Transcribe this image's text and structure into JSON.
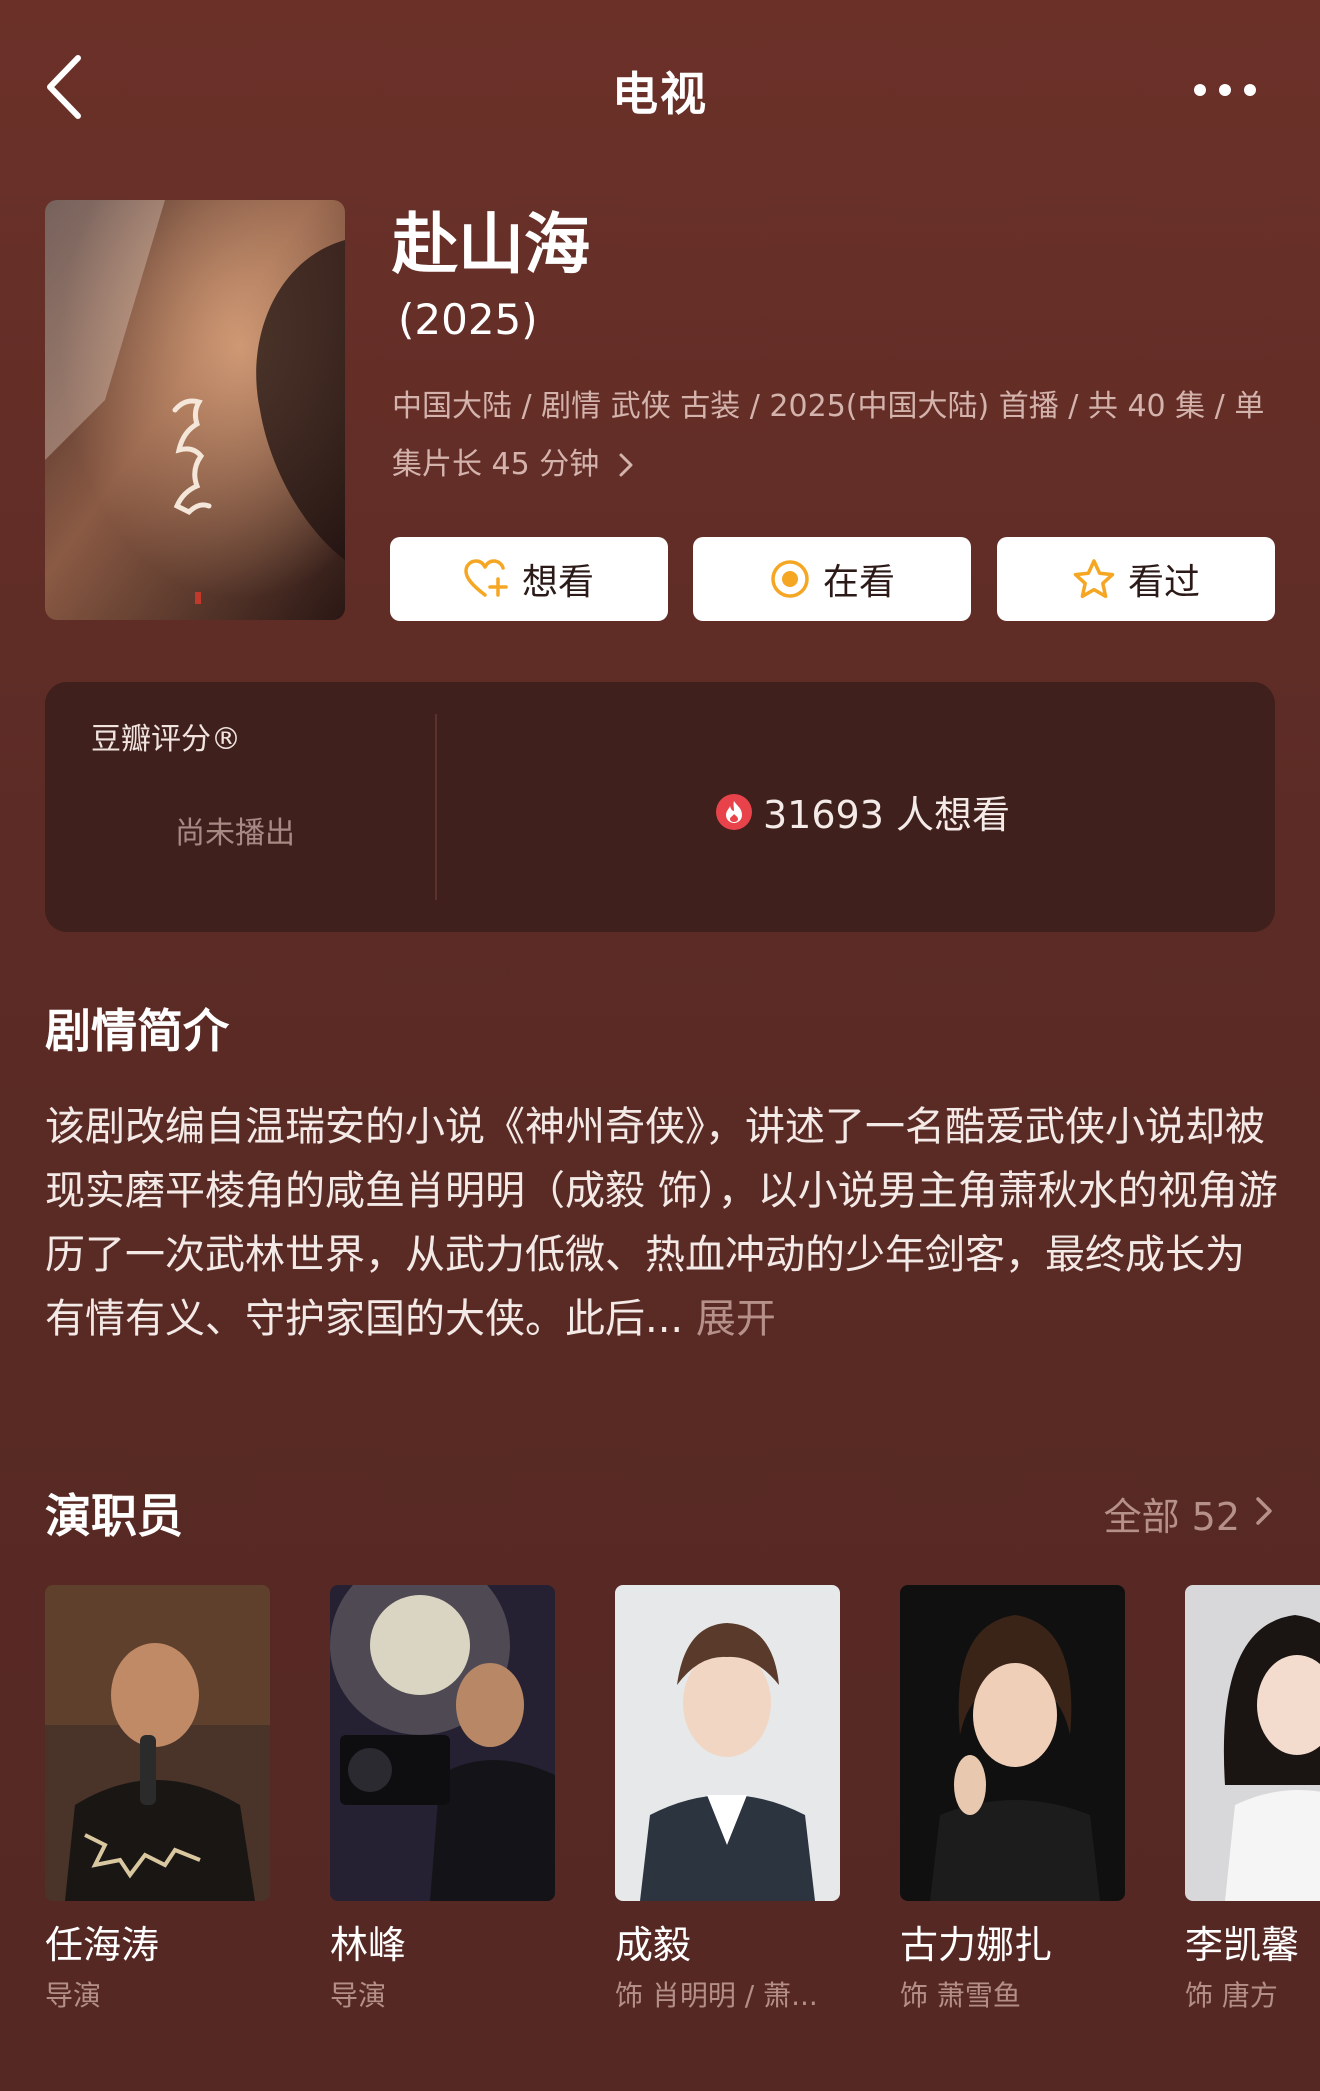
{
  "header": {
    "title": "电视"
  },
  "show": {
    "title": "赴山海",
    "year": "(2025)",
    "meta": "中国大陆 / 剧情 武侠 古装 / 2025(中国大陆) 首播 / 共 40 集 / 单集片长 45 分钟"
  },
  "actions": [
    {
      "label": "想看",
      "icon": "heart-plus-icon"
    },
    {
      "label": "在看",
      "icon": "target-circle-icon"
    },
    {
      "label": "看过",
      "icon": "star-icon"
    }
  ],
  "rating": {
    "label": "豆瓣评分®",
    "status": "尚未播出",
    "wish_count": "31693 人想看"
  },
  "synopsis": {
    "title": "剧情简介",
    "text": "该剧改编自温瑞安的小说《神州奇侠》，讲述了一名酷爱武侠小说却被现实磨平棱角的咸鱼肖明明（成毅 饰），以小说男主角萧秋水的视角游历了一次武林世界，从武力低微、热血冲动的少年剑客，最终成长为有情有义、守护家国的大侠。此后...",
    "expand": "展开"
  },
  "cast": {
    "title": "演职员",
    "all_label": "全部 52",
    "members": [
      {
        "name": "任海涛",
        "role": "导演"
      },
      {
        "name": "林峰",
        "role": "导演"
      },
      {
        "name": "成毅",
        "role": "饰 肖明明 / 萧..."
      },
      {
        "name": "古力娜扎",
        "role": "饰 萧雪鱼"
      },
      {
        "name": "李凯馨",
        "role": "饰 唐方"
      }
    ]
  },
  "colors": {
    "background": "#5c2b25",
    "card": "#3f201c",
    "accent": "#f5a623",
    "muted": "#b6918a"
  }
}
